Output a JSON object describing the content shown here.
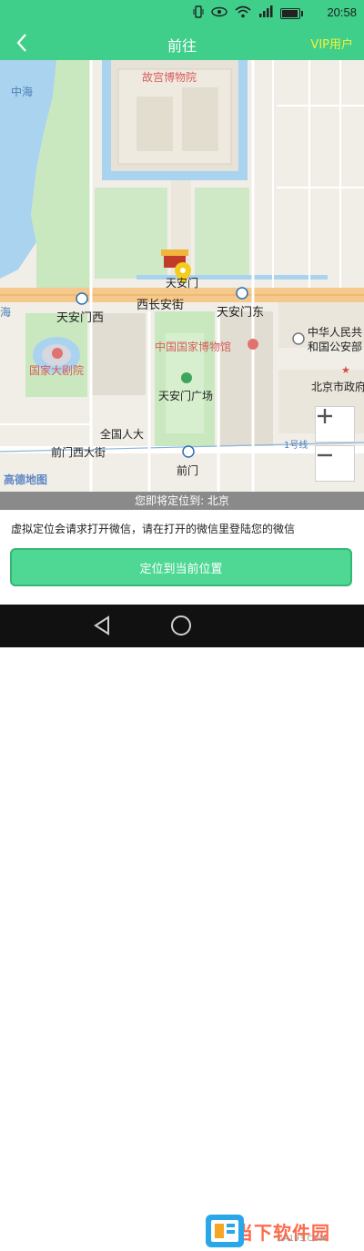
{
  "status_bar": {
    "time": "20:58",
    "icons": [
      "vibrate-icon",
      "eye-icon",
      "wifi-icon",
      "signal-icon",
      "battery-icon"
    ],
    "battery_level": 0.85
  },
  "nav": {
    "title": "前往",
    "vip_label": "VIP用户",
    "back_icon": "chevron-left-icon",
    "vip_color": "#f6f13b"
  },
  "map": {
    "labels": {
      "gugong": "故宫博物院",
      "zhonghai": "中海",
      "tiananmen": "天安门",
      "west_changan": "西长安街",
      "tiananmen_west": "天安门西",
      "tiananmen_east": "天安门东",
      "national_theater": "国家大剧院",
      "national_museum": "中国国家博物馆",
      "public_security_1": "中华人民共",
      "public_security_2": "和国公安部",
      "beijing_gov": "北京市政府",
      "hai": "海",
      "square": "天安门广场",
      "people_hall": "全国人大",
      "qianmen_west": "前门西大街",
      "qianmen": "前门",
      "line1": "1号线",
      "logo": "高德地图"
    },
    "zoom_in_icon": "plus-icon",
    "zoom_out_icon": "minus-icon",
    "marker_icon": "location-pin-icon"
  },
  "banner": {
    "text": "您即将定位到: 北京"
  },
  "info": {
    "text": "虚拟定位会请求打开微信，请在打开的微信里登陆您的微信",
    "button_label": "定位到当前位置"
  },
  "system_nav": {
    "back_icon": "triangle-back-icon",
    "home_icon": "circle-home-icon"
  },
  "watermark": {
    "text": "当下软件园",
    "sub": "LA193.COM"
  },
  "colors": {
    "accent": "#3fcf8a",
    "button": "#4fd894",
    "banner": "#8a8a8a"
  }
}
